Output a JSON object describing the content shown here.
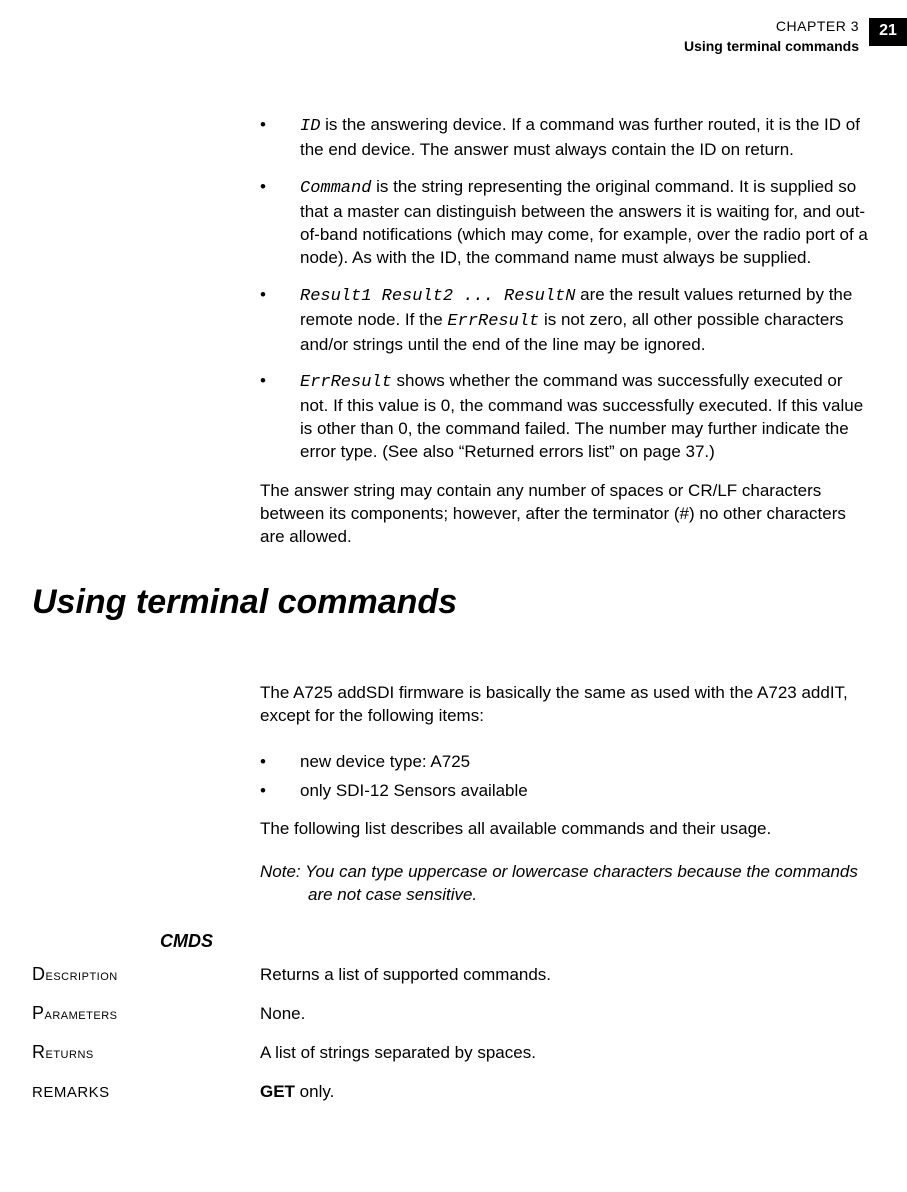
{
  "header": {
    "chapter_label": "CHAPTER 3",
    "section_name": "Using terminal commands",
    "page_number": "21"
  },
  "bullets_top": [
    {
      "code": "ID",
      "text_after": " is the answering device. If a command was further routed, it is the ID of the end device. The answer must always contain the ID on return."
    },
    {
      "code": "Command",
      "text_after": " is the string representing the original command. It is supplied so that a master can distinguish between the answers it is waiting for, and out-of-band notifications (which may come, for example, over the radio port of a node). As with the ID, the command name must always be supplied."
    },
    {
      "code": "Result1 Result2 ... ResultN",
      "text_after_1": " are the result values returned by the remote node. If the ",
      "code2": "ErrResult",
      "text_after_2": " is not zero, all other possible characters and/or strings until the end of the line may be ignored."
    },
    {
      "code": "ErrResult",
      "text_after": " shows whether the command was successfully executed or not. If this value is 0, the command was successfully executed. If this value is other than 0, the command failed. The number may further indicate the error type. (See also “Returned errors list” on page 37.)"
    }
  ],
  "post_bullets_para": "The answer string may contain any number of spaces or CR/LF characters between its components; however, after the terminator (#) no other characters are allowed.",
  "section_heading": "Using terminal commands",
  "intro_para": "The A725 addSDI firmware is basically the same as used with the A723 addIT, except for the following items:",
  "inner_bullets": [
    "new device type: A725",
    "only SDI-12 Sensors available"
  ],
  "post_inner_para": "The following list describes all available commands and their usage.",
  "note_label": "Note: ",
  "note_text": "You can type uppercase or lowercase characters because the commands are not case sensitive.",
  "cmd_title": "CMDS",
  "defs": {
    "description": {
      "label": "Description",
      "value": "Returns a list of supported commands."
    },
    "parameters": {
      "label": "Parameters",
      "value": "None."
    },
    "returns": {
      "label": "Returns",
      "value": "A list of strings separated by spaces."
    },
    "remarks": {
      "label": "REMARKS",
      "value_bold": "GET",
      "value_rest": " only."
    }
  }
}
